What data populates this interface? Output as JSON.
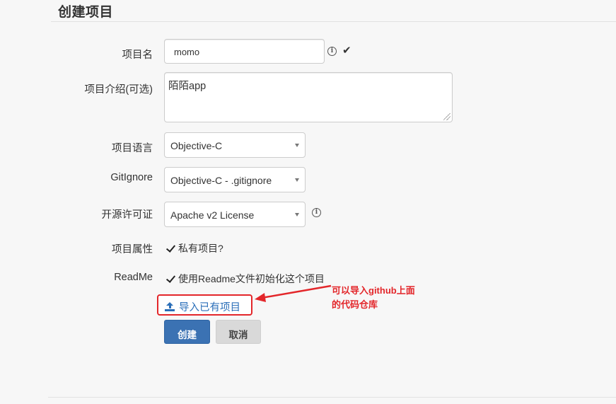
{
  "page": {
    "title": "创建项目"
  },
  "form": {
    "name": {
      "label": "项目名",
      "value": "momo"
    },
    "description": {
      "label": "项目介绍(可选)",
      "value": "陌陌app"
    },
    "language": {
      "label": "项目语言",
      "selected": "Objective-C"
    },
    "gitignore": {
      "label": "GitIgnore",
      "selected": "Objective-C - .gitignore"
    },
    "license": {
      "label": "开源许可证",
      "selected": "Apache v2 License"
    },
    "visibility": {
      "label": "项目属性",
      "checkbox_label": "私有项目?",
      "checked": true
    },
    "readme": {
      "label": "ReadMe",
      "checkbox_label": "使用Readme文件初始化这个项目",
      "checked": true
    },
    "import_link": "导入已有项目",
    "create_button": "创建",
    "cancel_button": "取消"
  },
  "annotation": {
    "line1": "可以导入github上面",
    "line2": "的代码仓库",
    "color": "#e3262a"
  },
  "icons": [
    "info-icon",
    "check-icon",
    "upload-icon",
    "chevron-down-icon",
    "resize-grip-icon"
  ]
}
